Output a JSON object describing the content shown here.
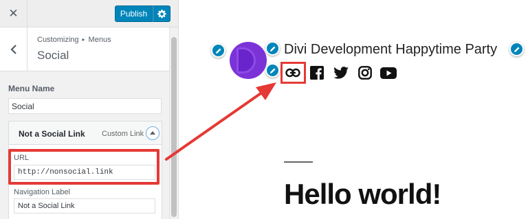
{
  "customizer": {
    "close_icon": "close-icon",
    "publish_label": "Publish",
    "settings_icon": "gear-icon",
    "back_icon": "chevron-left-icon",
    "breadcrumb": {
      "parent": "Customizing",
      "separator": "▸",
      "current": "Menus"
    },
    "section_title": "Social",
    "menu_name_label": "Menu Name",
    "menu_name_value": "Social",
    "menu_item": {
      "title": "Not a Social Link",
      "type": "Custom Link",
      "toggle_icon": "chevron-up-icon",
      "url_label": "URL",
      "url_value": "http://nonsocial.link",
      "nav_label_label": "Navigation Label",
      "nav_label_value": "Not a Social Link"
    }
  },
  "preview": {
    "site_title": "Divi Development Happytime Party",
    "social_icons": [
      "link-icon",
      "facebook-icon",
      "twitter-icon",
      "instagram-icon",
      "youtube-icon"
    ],
    "post_title": "Hello world!"
  },
  "colors": {
    "accent": "#0085ba",
    "highlight": "#e53935",
    "logo": "#7b33d8"
  }
}
